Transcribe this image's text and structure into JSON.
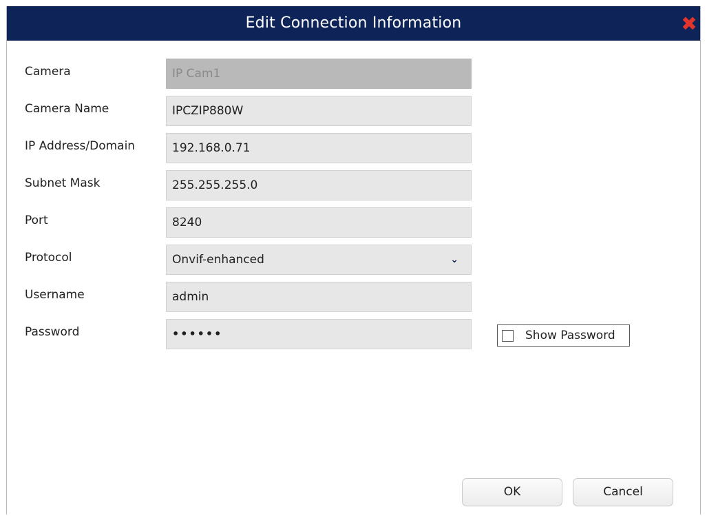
{
  "dialog": {
    "title": "Edit Connection Information",
    "close_icon": "close-icon",
    "close_symbol": "✖"
  },
  "form": {
    "camera": {
      "label": "Camera",
      "value": "IP Cam1"
    },
    "camera_name": {
      "label": "Camera Name",
      "value": "IPCZIP880W"
    },
    "ip_address": {
      "label": "IP Address/Domain",
      "value": "192.168.0.71"
    },
    "subnet_mask": {
      "label": "Subnet Mask",
      "value": "255.255.255.0"
    },
    "port": {
      "label": "Port",
      "value": "8240"
    },
    "protocol": {
      "label": "Protocol",
      "value": "Onvif-enhanced"
    },
    "username": {
      "label": "Username",
      "value": "admin"
    },
    "password": {
      "label": "Password",
      "value": "••••••"
    },
    "show_password": {
      "label": "Show Password",
      "checked": false
    }
  },
  "buttons": {
    "ok": "OK",
    "cancel": "Cancel"
  },
  "colors": {
    "titlebar": "#0e2358",
    "close": "#e1342c",
    "field_bg": "#e7e7e7",
    "disabled_field_bg": "#b9b9b9"
  }
}
